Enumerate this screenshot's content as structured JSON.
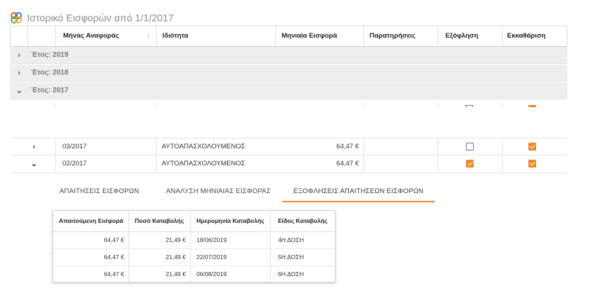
{
  "page": {
    "title": "Ιστορικό Εισφορών από 1/1/2017",
    "colors": {
      "accent": "#f0882a",
      "group_bg": "#eeeeee"
    }
  },
  "grid": {
    "columns": [
      "Μήνας Αναφοράς",
      "Ιδιότητα",
      "Μηνιαία Εισφορά",
      "Παρατηρήσεις",
      "Εξόφληση",
      "Εκκαθάριση"
    ],
    "sort_icon": "arrow-down-icon",
    "groups": [
      {
        "label": "Έτος: 2019",
        "expanded": false
      },
      {
        "label": "Έτος: 2018",
        "expanded": false
      },
      {
        "label": "Έτος: 2017",
        "expanded": true
      }
    ],
    "rows": [
      {
        "month": "03/2017",
        "role": "ΑΥΤΟΑΠΑΣΧΟΛΟΥΜΕΝΟΣ",
        "amount": "64,47 €",
        "notes": "",
        "paid": false,
        "cleared": true,
        "expanded": false
      },
      {
        "month": "02/2017",
        "role": "ΑΥΤΟΑΠΑΣΧΟΛΟΥΜΕΝΟΣ",
        "amount": "64,47 €",
        "notes": "",
        "paid": true,
        "cleared": true,
        "expanded": true
      }
    ]
  },
  "detail": {
    "tabs": [
      {
        "label": "ΑΠΑΙΤΗΣΕΙΣ ΕΙΣΦΟΡΩΝ",
        "active": false
      },
      {
        "label": "ΑΝΑΛΥΣΗ ΜΗΝΙΑΙΑΣ ΕΙΣΦΟΡΑΣ",
        "active": false
      },
      {
        "label": "ΕΞΟΦΛΗΣΕΙΣ ΑΠΑΙΤΗΣΕΩΝ ΕΙΣΦΟΡΩΝ",
        "active": true
      }
    ],
    "table": {
      "columns": [
        "Απαιτούμενη Εισφορά",
        "Ποσό Καταβολής",
        "Ημερομηνία Καταβολής",
        "Είδος Καταβολής"
      ],
      "rows": [
        [
          "64,47 €",
          "21,49 €",
          "18/06/2019",
          "4Η ΔΟΣΗ"
        ],
        [
          "64,47 €",
          "21,49 €",
          "22/07/2019",
          "5Η ΔΟΣΗ"
        ],
        [
          "64,47 €",
          "21,49 €",
          "06/08/2019",
          "6Η ΔΟΣΗ"
        ]
      ]
    }
  }
}
